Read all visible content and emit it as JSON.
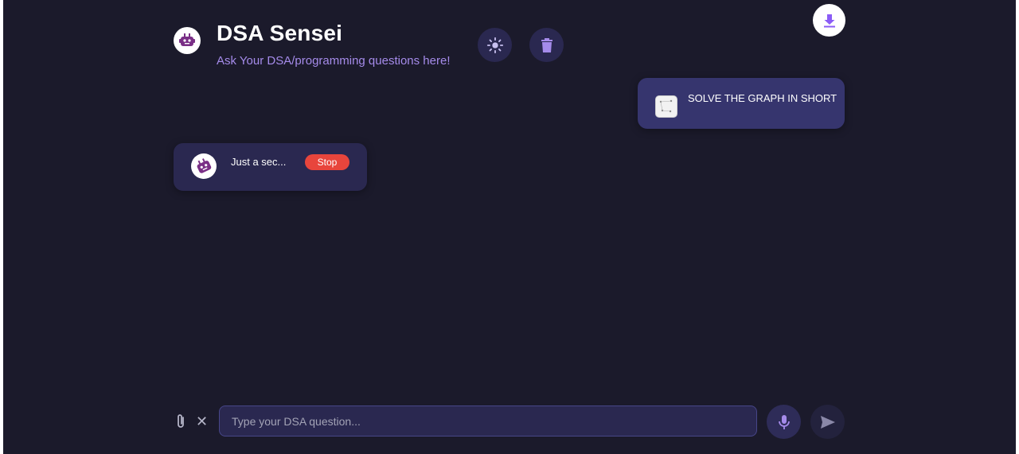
{
  "header": {
    "title": "DSA Sensei",
    "subtitle": "Ask Your DSA/programming questions here!",
    "avatar_icon": "robot-icon",
    "theme_toggle_icon": "sun-icon",
    "clear_chat_icon": "trash-icon",
    "download_icon": "download-icon"
  },
  "messages": [
    {
      "role": "user",
      "attachment_icon": "image-thumbnail",
      "text": "SOLVE THE GRAPH IN SHORT"
    },
    {
      "role": "bot",
      "avatar_icon": "robot-icon",
      "text": "Just a sec...",
      "stop_label": "Stop"
    }
  ],
  "composer": {
    "attach_icon": "paperclip-icon",
    "clear_symbol": "✕",
    "placeholder": "Type your DSA question...",
    "value": "",
    "mic_icon": "microphone-icon",
    "send_icon": "send-icon"
  },
  "colors": {
    "background": "#1b1a2b",
    "accent": "#a58bea",
    "user_bubble": "#36356e",
    "bot_bubble": "#2a2850",
    "stop": "#e8453c",
    "download": "#8b5cf6"
  }
}
